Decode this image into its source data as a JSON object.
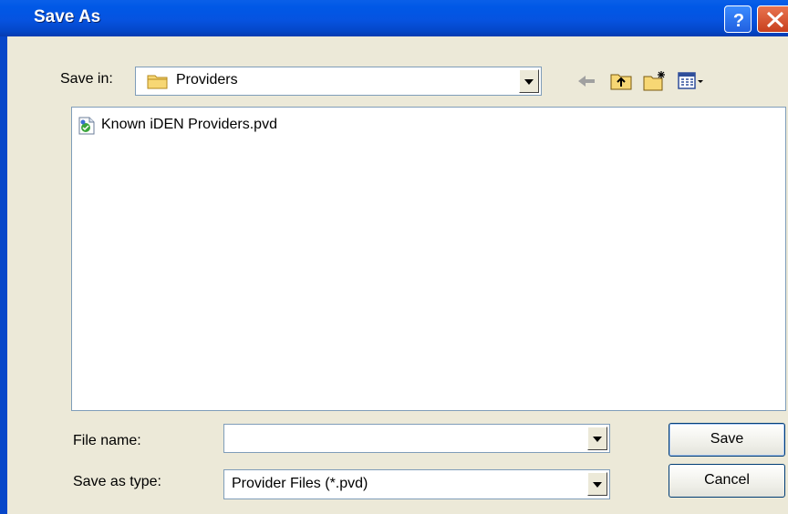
{
  "window": {
    "title": "Save As"
  },
  "title_buttons": {
    "help_icon": "help-icon",
    "close_icon": "close-icon"
  },
  "save_in": {
    "label": "Save in:",
    "value": "Providers",
    "icon": "folder-icon"
  },
  "toolbar": {
    "icons": [
      "back-arrow-icon",
      "up-one-level-icon",
      "new-folder-icon",
      "view-menu-icon"
    ]
  },
  "files": [
    {
      "name": "Known iDEN Providers.pvd",
      "icon": "pvd-file-icon"
    }
  ],
  "file_name": {
    "label": "File name:",
    "value": ""
  },
  "save_as_type": {
    "label": "Save as type:",
    "value": "Provider Files (*.pvd)"
  },
  "buttons": {
    "save": "Save",
    "cancel": "Cancel"
  },
  "colors": {
    "titlebar": "#0058E6",
    "dialog_bg": "#ECE9D8",
    "close": "#C8401E"
  }
}
